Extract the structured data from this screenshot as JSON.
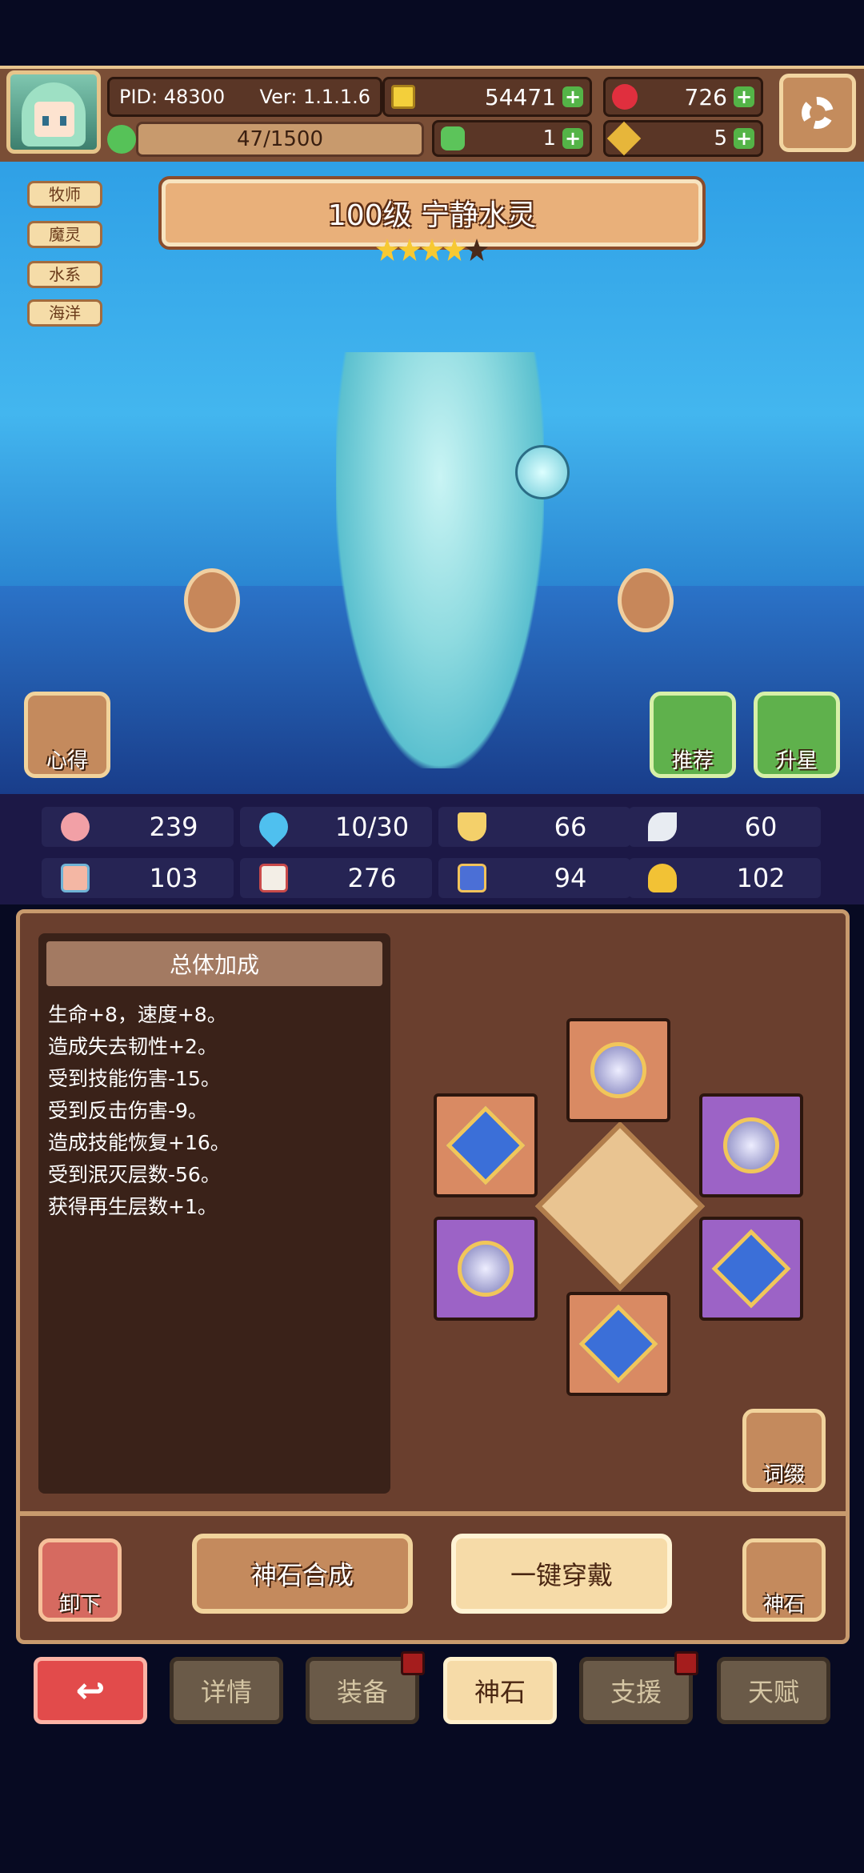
{
  "header": {
    "pid": "PID: 48300",
    "version": "Ver: 1.1.1.6",
    "gold": "54471",
    "gems": "726",
    "exp": "47/1500",
    "clover": "1",
    "keys": "5"
  },
  "tags": [
    "牧师",
    "魔灵",
    "水系",
    "海洋"
  ],
  "hero": {
    "title": "100级  宁静水灵",
    "stars_filled": 4,
    "stars_total": 5
  },
  "side_buttons": {
    "notes": "心得",
    "recommend": "推荐",
    "star_up": "升星"
  },
  "stats": {
    "row1": [
      "239",
      "10/30",
      "66",
      "60"
    ],
    "row2": [
      "103",
      "276",
      "94",
      "102"
    ]
  },
  "bonus": {
    "title": "总体加成",
    "lines": [
      "生命+8，速度+8。",
      "造成失去韧性+2。",
      "受到技能伤害-15。",
      "受到反击伤害-9。",
      "造成技能恢复+16。",
      "受到泯灭层数-56。",
      "获得再生层数+1。"
    ]
  },
  "panel_buttons": {
    "affix": "词缀",
    "unequip": "卸下",
    "synth": "神石合成",
    "equip_all": "一键穿戴",
    "godstone": "神石"
  },
  "tabs": [
    "详情",
    "装备",
    "神石",
    "支援",
    "天赋"
  ],
  "colors": {
    "accent_red": "#e24b4b",
    "panel_brown": "#6a3f2e",
    "active_tab": "#f6dba8"
  }
}
